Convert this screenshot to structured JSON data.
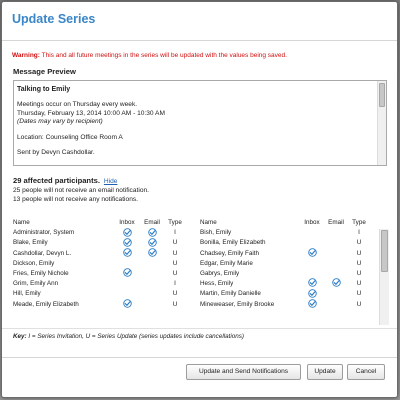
{
  "dialog": {
    "title": "Update Series",
    "warning_prefix": "Warning:",
    "warning_text": "This and all future meetings in the series will be updated with the values being saved."
  },
  "preview": {
    "label": "Message Preview",
    "subject": "Talking to Emily",
    "line1": "Meetings occur on Thursday every week.",
    "line2": "Thursday, February 13, 2014 10:00 AM - 10:30 AM",
    "line3": "(Dates may vary by recipient)",
    "location": "Location: Counseling Office Room A",
    "sender": "Sent by Devyn Cashdollar."
  },
  "affected": {
    "summary": "29 affected participants.",
    "hide_label": "Hide",
    "no_email": "25 people will not receive an email notification.",
    "no_notifications": "13 people will not receive any notifications."
  },
  "columns": {
    "name": "Name",
    "inbox": "Inbox",
    "email": "Email",
    "type": "Type"
  },
  "participants_left": [
    {
      "name": "Administrator, System",
      "inbox": true,
      "email": true,
      "type": "I"
    },
    {
      "name": "Blake, Emily",
      "inbox": true,
      "email": true,
      "type": "U"
    },
    {
      "name": "Cashdollar, Devyn L.",
      "inbox": true,
      "email": true,
      "type": "U"
    },
    {
      "name": "Dickson, Emily",
      "inbox": false,
      "email": false,
      "type": "U"
    },
    {
      "name": "Fries, Emily Nichole",
      "inbox": true,
      "email": false,
      "type": "U"
    },
    {
      "name": "Grim, Emily Ann",
      "inbox": false,
      "email": false,
      "type": "I"
    },
    {
      "name": "Hill, Emily",
      "inbox": false,
      "email": false,
      "type": "U"
    },
    {
      "name": "Meade, Emily Elizabeth",
      "inbox": true,
      "email": false,
      "type": "U"
    }
  ],
  "participants_right": [
    {
      "name": "Bish, Emily",
      "inbox": false,
      "email": false,
      "type": "I"
    },
    {
      "name": "Bonilla, Emily Elizabeth",
      "inbox": false,
      "email": false,
      "type": "U"
    },
    {
      "name": "Chadsey, Emily Faith",
      "inbox": true,
      "email": false,
      "type": "U"
    },
    {
      "name": "Edgar, Emily Marie",
      "inbox": false,
      "email": false,
      "type": "U"
    },
    {
      "name": "Gabrys, Emily",
      "inbox": false,
      "email": false,
      "type": "U"
    },
    {
      "name": "Hess, Emily",
      "inbox": true,
      "email": true,
      "type": "U"
    },
    {
      "name": "Martin, Emily Danielle",
      "inbox": true,
      "email": false,
      "type": "U"
    },
    {
      "name": "Mineweaser, Emily Brooke",
      "inbox": true,
      "email": false,
      "type": "U"
    }
  ],
  "key": {
    "label": "Key:",
    "text": "I = Series Invitation, U = Series Update (series updates include cancellations)"
  },
  "buttons": {
    "notify": "Update and Send Notifications",
    "update": "Update",
    "cancel": "Cancel"
  },
  "colors": {
    "title": "#3a86c7",
    "warning": "#d01010",
    "check": "#2a7cc6",
    "link": "#1f5fb5"
  }
}
